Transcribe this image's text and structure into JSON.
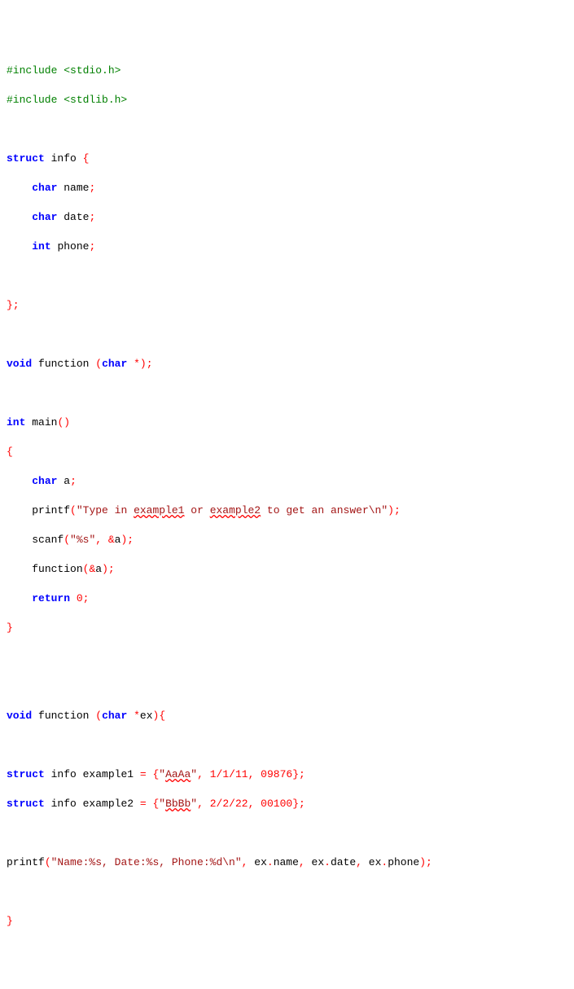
{
  "code": {
    "l1": {
      "pre_hash": "#include ",
      "pre_hdr": "<stdio.h>"
    },
    "l2": {
      "pre_hash": "#include ",
      "pre_hdr": "<stdlib.h>"
    },
    "l4": {
      "kw1": "struct",
      "sp": " ",
      "id": "info ",
      "pun": "{"
    },
    "l5": {
      "indent": "    ",
      "kw": "char",
      "sp": " ",
      "id": "name",
      "pun": ";"
    },
    "l6": {
      "indent": "    ",
      "kw": "char",
      "sp": " ",
      "id": "date",
      "pun": ";"
    },
    "l7": {
      "indent": "    ",
      "kw": "int",
      "sp": " ",
      "id": "phone",
      "pun": ";"
    },
    "l9": {
      "pun": "};"
    },
    "l11": {
      "kw1": "void",
      "sp1": " ",
      "id": "function ",
      "pun1": "(",
      "kw2": "char",
      "sp2": " ",
      "pun2": "*);"
    },
    "l13": {
      "kw": "int",
      "sp": " ",
      "id": "main",
      "pun": "()"
    },
    "l14": {
      "pun": "{"
    },
    "l15": {
      "indent": "    ",
      "kw": "char",
      "sp": " ",
      "id": "a",
      "pun": ";"
    },
    "l16": {
      "indent": "    ",
      "id": "printf",
      "pun1": "(",
      "str1": "\"Type in ",
      "sq1": "example1",
      "str2": " or ",
      "sq2": "example2",
      "str3": " to get an answer\\n\"",
      "pun2": ");"
    },
    "l17": {
      "indent": "    ",
      "id": "scanf",
      "pun1": "(",
      "str": "\"%s\"",
      "pun2": ", &",
      "id2": "a",
      "pun3": ");"
    },
    "l18": {
      "indent": "    ",
      "id": "function",
      "pun1": "(&",
      "id2": "a",
      "pun2": ");"
    },
    "l19": {
      "indent": "    ",
      "kw": "return",
      "sp": " ",
      "num": "0",
      "pun": ";"
    },
    "l20": {
      "pun": "}"
    },
    "l23": {
      "kw1": "void",
      "sp1": " ",
      "id": "function ",
      "pun1": "(",
      "kw2": "char",
      "sp2": " ",
      "pun2": "*",
      "id2": "ex",
      "pun3": "){"
    },
    "l25": {
      "kw1": "struct",
      "sp1": " ",
      "id1": "info example1 ",
      "pun1": "= {",
      "str": "\"",
      "sq": "AaAa",
      "str2": "\"",
      "pun2": ", ",
      "num1": "1",
      "pun3": "/",
      "num2": "1",
      "pun4": "/",
      "num3": "11",
      "pun5": ", ",
      "num4": "09876",
      "pun6": "};"
    },
    "l26": {
      "kw1": "struct",
      "sp1": " ",
      "id1": "info example2 ",
      "pun1": "= {",
      "str": "\"",
      "sq": "BbBb",
      "str2": "\"",
      "pun2": ", ",
      "num1": "2",
      "pun3": "/",
      "num2": "2",
      "pun4": "/",
      "num3": "22",
      "pun5": ", ",
      "num4": "00100",
      "pun6": "};"
    },
    "l28": {
      "id": "printf",
      "pun1": "(",
      "str": "\"Name:%s, Date:%s, Phone:%d\\n\"",
      "pun2": ", ",
      "id1": "ex",
      "pun3": ".",
      "id2": "name",
      "pun4": ", ",
      "id3": "ex",
      "pun5": ".",
      "id4": "date",
      "pun6": ", ",
      "id5": "ex",
      "pun7": ".",
      "id6": "phone",
      "pun8": ");"
    },
    "l30": {
      "pun": "}"
    }
  }
}
